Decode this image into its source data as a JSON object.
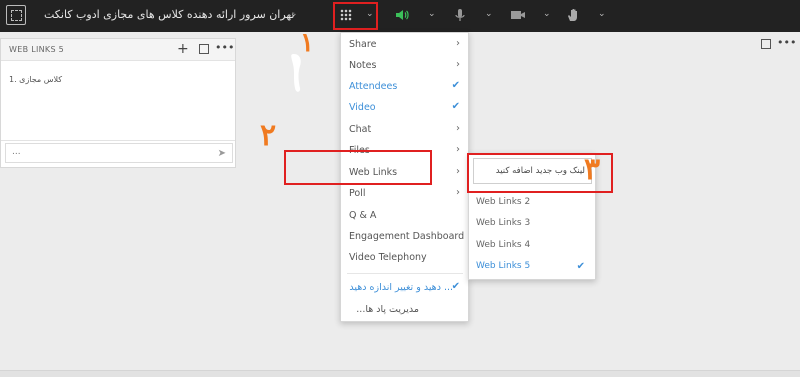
{
  "app": {
    "title": "تهران سرور ارائه دهنده کلاس های مجازی ادوب کانکت"
  },
  "toolbar": {
    "icons": [
      "fullscreen-icon",
      "apps-grid-icon",
      "speaker-icon",
      "microphone-icon",
      "camera-icon",
      "raise-hand-icon"
    ],
    "speaker_color": "#3cc05a"
  },
  "pod": {
    "title": "WEB LINKS 5",
    "item": "کلاس مجازی .1",
    "input_placeholder": "..."
  },
  "menu": {
    "items": [
      {
        "label": "Share",
        "state": "submenu"
      },
      {
        "label": "Notes",
        "state": "submenu"
      },
      {
        "label": "Attendees",
        "state": "checked"
      },
      {
        "label": "Video",
        "state": "checked"
      },
      {
        "label": "Chat",
        "state": "submenu"
      },
      {
        "label": "Files",
        "state": "submenu"
      },
      {
        "label": "Web Links",
        "state": "submenu"
      },
      {
        "label": "Poll",
        "state": "submenu"
      },
      {
        "label": "Q & A",
        "state": "none"
      },
      {
        "label": "Engagement Dashboard",
        "state": "none"
      },
      {
        "label": "Video Telephony",
        "state": "none"
      }
    ],
    "footer_items": [
      {
        "label": "... دهید و تغییر اندازه دهید",
        "state": "checked"
      },
      {
        "label": "مدیریت پاد ها...",
        "state": "none"
      }
    ]
  },
  "submenu": {
    "add_label": "لینک وب جدید اضافه کنید",
    "items": [
      {
        "label": "Web Links 2",
        "checked": false
      },
      {
        "label": "Web Links 3",
        "checked": false
      },
      {
        "label": "Web Links 4",
        "checked": false
      },
      {
        "label": "Web Links 5",
        "checked": true
      }
    ]
  },
  "annotations": [
    "۱",
    "۲",
    "۳"
  ],
  "colors": {
    "accent": "#3d8fd8",
    "annotation_box": "#e02020",
    "annotation_number": "#f07a20"
  }
}
